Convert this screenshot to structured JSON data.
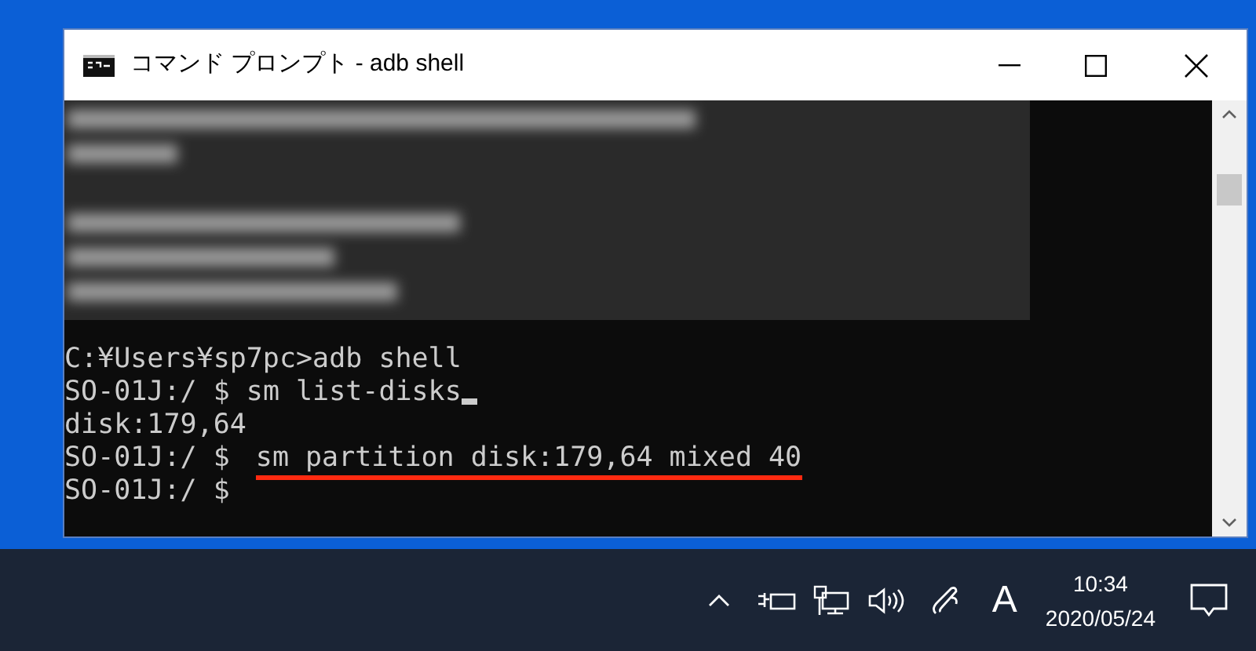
{
  "window": {
    "title": "コマンド プロンプト - adb  shell"
  },
  "console": {
    "lines": [
      {
        "prompt": "C:¥Users¥sp7pc>",
        "command": "adb shell",
        "cursor": false,
        "highlighted": false
      },
      {
        "prompt": "SO-01J:/ $ ",
        "command": "sm list-disks",
        "cursor": true,
        "highlighted": false
      },
      {
        "output": "disk:179,64"
      },
      {
        "prompt": "SO-01J:/ $ ",
        "command": "sm partition disk:179,64 mixed 40",
        "cursor": false,
        "highlighted": true
      },
      {
        "prompt": "SO-01J:/ $",
        "cursor": false,
        "highlighted": false
      }
    ]
  },
  "taskbar": {
    "ime": "A",
    "time": "10:34",
    "date": "2020/05/24"
  }
}
